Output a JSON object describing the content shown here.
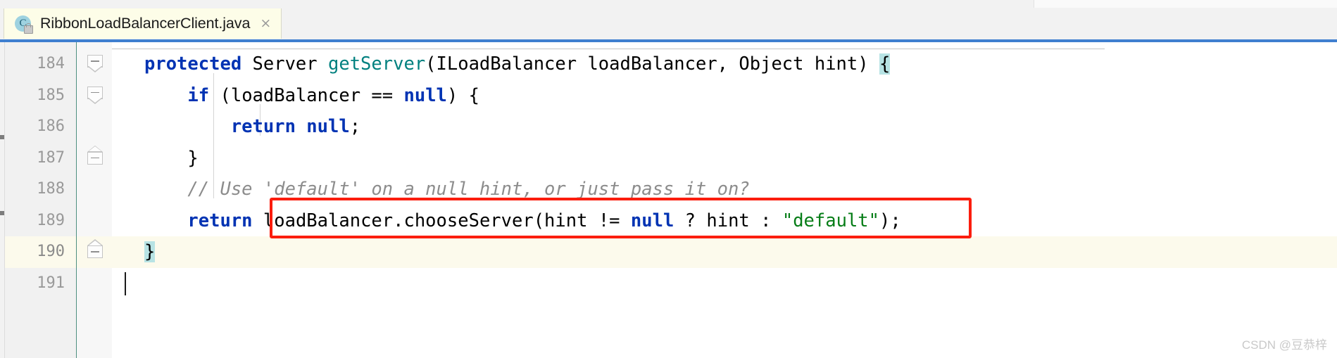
{
  "window": {
    "app": "intellij-idea-editor"
  },
  "tab": {
    "icon_letter": "C",
    "icon_name": "java-class-icon",
    "lock_icon_name": "lock-overlay-icon",
    "title": "RibbonLoadBalancerClient.java",
    "close_glyph": "×"
  },
  "editor": {
    "accent_color": "#3f7fd0",
    "current_line_bg": "#fcfaec",
    "brace_highlight_color": "#b7e3e4",
    "annotation_color": "#fb1d0e",
    "keyword_color": "#0033b3",
    "method_color": "#00807f",
    "string_color": "#067d17",
    "comment_color": "#8c8c8c",
    "lines": [
      {
        "number": "184",
        "current": false,
        "fold": "minus-down",
        "tokens": [
          {
            "t": "protected",
            "c": "kw"
          },
          {
            "t": " Server ",
            "c": "type"
          },
          {
            "t": "getServer",
            "c": "meth"
          },
          {
            "t": "(ILoadBalancer loadBalancer, Object hint) ",
            "c": "type"
          },
          {
            "t": "{",
            "c": "brace-hl"
          }
        ]
      },
      {
        "number": "185",
        "current": false,
        "fold": "minus-down",
        "tokens": [
          {
            "t": "    ",
            "c": "type"
          },
          {
            "t": "if",
            "c": "kw"
          },
          {
            "t": " (loadBalancer == ",
            "c": "type"
          },
          {
            "t": "null",
            "c": "kw"
          },
          {
            "t": ") {",
            "c": "type"
          }
        ]
      },
      {
        "number": "186",
        "current": false,
        "fold": "",
        "tokens": [
          {
            "t": "        ",
            "c": "type"
          },
          {
            "t": "return null",
            "c": "kw"
          },
          {
            "t": ";",
            "c": "type"
          }
        ]
      },
      {
        "number": "187",
        "current": false,
        "fold": "minus-up",
        "tokens": [
          {
            "t": "    }",
            "c": "type"
          }
        ]
      },
      {
        "number": "188",
        "current": false,
        "fold": "",
        "tokens": [
          {
            "t": "    // Use 'default' on a null hint, or just pass it on?",
            "c": "cmt"
          }
        ]
      },
      {
        "number": "189",
        "current": false,
        "fold": "",
        "tokens": [
          {
            "t": "    ",
            "c": "type"
          },
          {
            "t": "return",
            "c": "kw"
          },
          {
            "t": " loadBalancer.chooseServer(hint != ",
            "c": "type"
          },
          {
            "t": "null",
            "c": "kw"
          },
          {
            "t": " ? hint : ",
            "c": "type"
          },
          {
            "t": "\"default\"",
            "c": "str"
          },
          {
            "t": ");",
            "c": "type"
          }
        ]
      },
      {
        "number": "190",
        "current": true,
        "fold": "minus-up",
        "tokens": [
          {
            "t": "}",
            "c": "brace-hl"
          }
        ]
      },
      {
        "number": "191",
        "current": false,
        "fold": "",
        "tokens": []
      }
    ]
  },
  "annotation": {
    "name": "red-highlight-box",
    "target_line": "189",
    "target_text": "loadBalancer.chooseServer(hint != null ? hint : \"default\");"
  },
  "watermark": {
    "text": "CSDN @豆恭梓"
  }
}
